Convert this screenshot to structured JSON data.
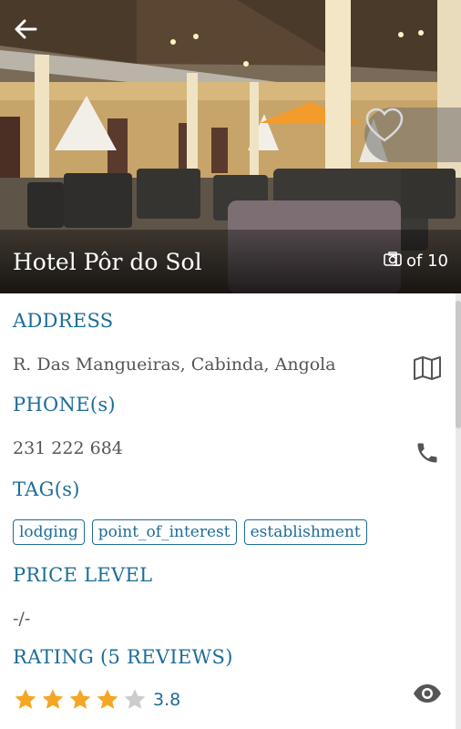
{
  "hero": {
    "title": "Hotel Pôr do Sol",
    "photo_counter": "1 of 10"
  },
  "sections": {
    "address": {
      "heading": "ADDRESS",
      "value": "R. Das Mangueiras, Cabinda, Angola"
    },
    "phone": {
      "heading": "PHONE(s)",
      "value": "231 222 684"
    },
    "tags": {
      "heading": "TAG(s)",
      "items": [
        "lodging",
        "point_of_interest",
        "establishment"
      ]
    },
    "price": {
      "heading": "PRICE LEVEL",
      "value": "-/-"
    },
    "rating": {
      "heading": "RATING (5 REVIEWS)",
      "value": "3.8",
      "stars_filled": 4,
      "stars_total": 5
    }
  },
  "colors": {
    "accent": "#1d6c98",
    "text_muted": "#555555",
    "star_filled": "#f5a623",
    "star_empty": "#cccccc"
  },
  "icons": {
    "back": "arrow-left-icon",
    "favorite": "heart-icon",
    "photos": "camera-icon",
    "map": "map-icon",
    "phone": "phone-icon",
    "view": "eye-icon"
  }
}
